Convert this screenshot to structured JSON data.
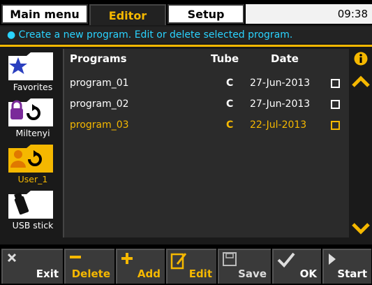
{
  "tabs": {
    "main": "Main menu",
    "editor": "Editor",
    "setup": "Setup"
  },
  "clock": "09:38",
  "info": "● Create a new program. Edit or delete selected program.",
  "sidebar": {
    "items": [
      {
        "label": "Favorites"
      },
      {
        "label": "Miltenyi"
      },
      {
        "label": "User_1"
      },
      {
        "label": "USB stick"
      }
    ]
  },
  "list": {
    "headers": {
      "programs": "Programs",
      "tube": "Tube",
      "date": "Date"
    },
    "rows": [
      {
        "name": "program_01",
        "tube": "C",
        "date": "27-Jun-2013"
      },
      {
        "name": "program_02",
        "tube": "C",
        "date": "27-Jun-2013"
      },
      {
        "name": "program_03",
        "tube": "C",
        "date": "22-Jul-2013"
      }
    ]
  },
  "toolbar": {
    "exit": "Exit",
    "delete": "Delete",
    "add": "Add",
    "edit": "Edit",
    "save": "Save",
    "ok": "OK",
    "start": "Start"
  },
  "colors": {
    "accent": "#f5b800",
    "info_text": "#2ad3ff",
    "favorites_star": "#2a3fbf",
    "lock": "#7a2a9a"
  }
}
